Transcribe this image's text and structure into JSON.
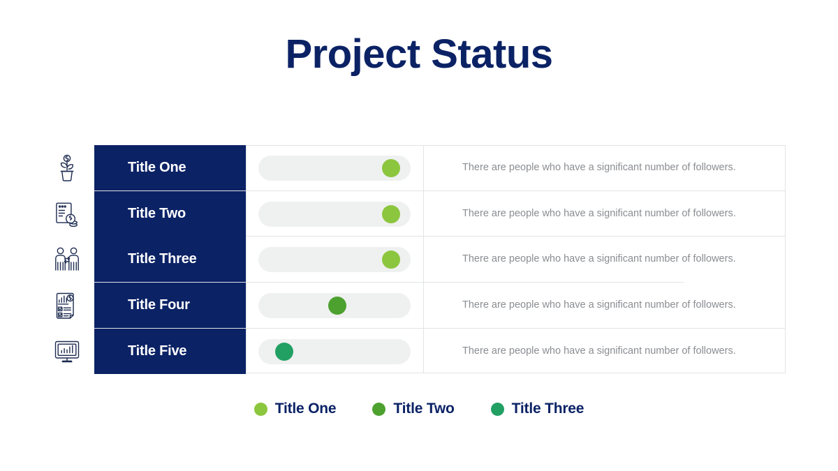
{
  "slide": {
    "title": "Project Status"
  },
  "theme": {
    "navy": "#0B2265",
    "track": "#eff0f0",
    "border": "#e2e3e5",
    "body_text": "#8a8d91",
    "green_light": "#8CC63E",
    "green_medium": "#4CA12F",
    "green_teal": "#22A063"
  },
  "table": {
    "rows": [
      {
        "icon": "money-plant-icon",
        "title": "Title One",
        "progress": 87,
        "knob_color": "#8CC63E",
        "description": "There are people who have a significant number of followers."
      },
      {
        "icon": "invoice-coins-icon",
        "title": "Title Two",
        "progress": 87,
        "knob_color": "#8CC63E",
        "description": "There are people who have a significant number of followers."
      },
      {
        "icon": "people-exchange-icon",
        "title": "Title Three",
        "progress": 87,
        "knob_color": "#8CC63E",
        "description": "There are people who have a significant number of followers."
      },
      {
        "icon": "financial-report-icon",
        "title": "Title Four",
        "progress": 52,
        "knob_color": "#4CA12F",
        "description": "There are people who have a significant number of followers."
      },
      {
        "icon": "monitor-chart-icon",
        "title": "Title Five",
        "progress": 17,
        "knob_color": "#22A063",
        "description": "There are people who have a significant number of followers."
      }
    ]
  },
  "legend": {
    "items": [
      {
        "label": "Title One",
        "color": "#8CC63E"
      },
      {
        "label": "Title Two",
        "color": "#4CA12F"
      },
      {
        "label": "Title Three",
        "color": "#22A063"
      }
    ]
  }
}
